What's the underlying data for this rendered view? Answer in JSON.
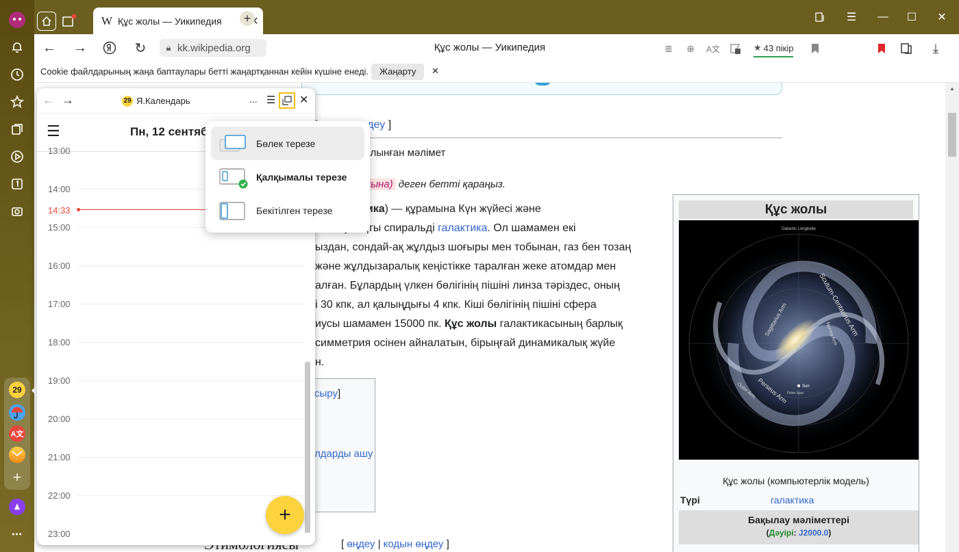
{
  "tab": {
    "favicon": "W",
    "title": "Құс жолы — Уикипедия",
    "close": "✕"
  },
  "toolbar": {
    "url": "kk.wikipedia.org",
    "page_title": "Құс жолы — Уикипедия",
    "reviews": "43 пікір",
    "ext_badge": "1"
  },
  "infobar": {
    "message": "Cookie файлдарының жаңа баптаулары бетті жаңартқаннан кейін күшіне енеді.",
    "button": "Жаңарту",
    "close": "✕"
  },
  "rail": {
    "calendar_badge": "29",
    "more": "•••"
  },
  "panel": {
    "app_badge": "29",
    "app_name": "Я.Календарь",
    "more": "...",
    "date": "Пн, 12 сентября",
    "hours": [
      "13:00",
      "14:00",
      "15:00",
      "16:00",
      "17:00",
      "18:00",
      "19:00",
      "20:00",
      "21:00",
      "22:00",
      "23:00"
    ],
    "now": "14:33",
    "fab": "+"
  },
  "menu": {
    "items": [
      {
        "label": "Бөлек терезе"
      },
      {
        "label": "Қалқымалы терезе"
      },
      {
        "label": "Бекітілген терезе"
      }
    ]
  },
  "wiki": {
    "edit_section_suffix": "| ",
    "edit_code": "кодын өңдеу",
    "edit_code_bracket": " ]",
    "source_line": "ниясынан алынған мәлімет",
    "disambig_link": "ктика (мағына)",
    "disambig_rest": " деген бетті қараңыз.",
    "p1_a": "ен ",
    "p1_b": "Галактика",
    "p1_c": ") — құрамына Күн жүйесі және",
    "p2_a": "лып аумақты спиральді ",
    "p2_link": "галактика",
    "p2_b": ". Ол шамамен екі",
    "p3": "ыздан, сондай-ақ жұлдыз шоғыры мен тобынан, газ бен тозаң",
    "p4": "және жұлдызаралық кеңістікке таралған жеке атомдар мен",
    "p5": "алған. Бұлардың үлкен бөлігінің пішіні линза тәріздес, оның",
    "p6": "і 30 кпк, ал қалыңдығы 4 кпк. Кіші бөлігінің пішіні сфера",
    "p7_a": "иусы шамамен 15000 пк. ",
    "p7_b": "Құс жолы",
    "p7_c": " галактикасының барлық",
    "p8": "симметрия осінен айналатын, бірыңғай динамикалық жүйе",
    "p9": "н.",
    "toc_1": "сыру",
    "toc_1_br": "]",
    "toc_2": "лдарды ашу",
    "heading_bottom": "Этимологиясы",
    "heading_edit": "өңдеу",
    "heading_code": "кодын өңдеу"
  },
  "infobox": {
    "title": "Құс жолы",
    "caption": "Құс жолы (компьютерлік модель)",
    "type_label": "Түрі",
    "type_value": "галактика",
    "obs_header": "Бақылау мәліметтері",
    "epoch_label": "Дәуірі",
    "epoch_value": "J2000.0",
    "img_labels": {
      "top": "Galactic Longitude",
      "scutum": "Scutum-Centaurus Arm",
      "sagittarius": "Sagittarius Arm",
      "norma": "Norma Arm",
      "perseus": "Perseus Arm",
      "outer": "Outer Arm",
      "sun": "Sun",
      "orion": "Orion Spur"
    }
  },
  "colors": {
    "accent": "#fcd23d",
    "link": "#3366cc",
    "now_line": "#e8473b",
    "title_bar": "#5a4a12"
  }
}
